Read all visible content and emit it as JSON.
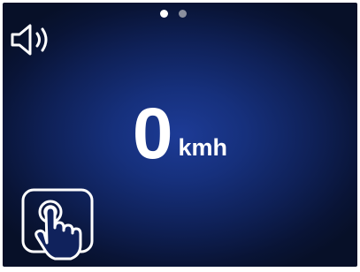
{
  "pager": {
    "pages": 2,
    "active_index": 0
  },
  "speedometer": {
    "value": "0",
    "unit": "kmh"
  },
  "icons": {
    "sound": "speaker-icon",
    "touch": "touch-gesture-icon"
  },
  "colors": {
    "background_center": "#1d3b96",
    "background_edge": "#071028",
    "foreground": "#ffffff",
    "inactive_dot": "#8a8f9e"
  }
}
